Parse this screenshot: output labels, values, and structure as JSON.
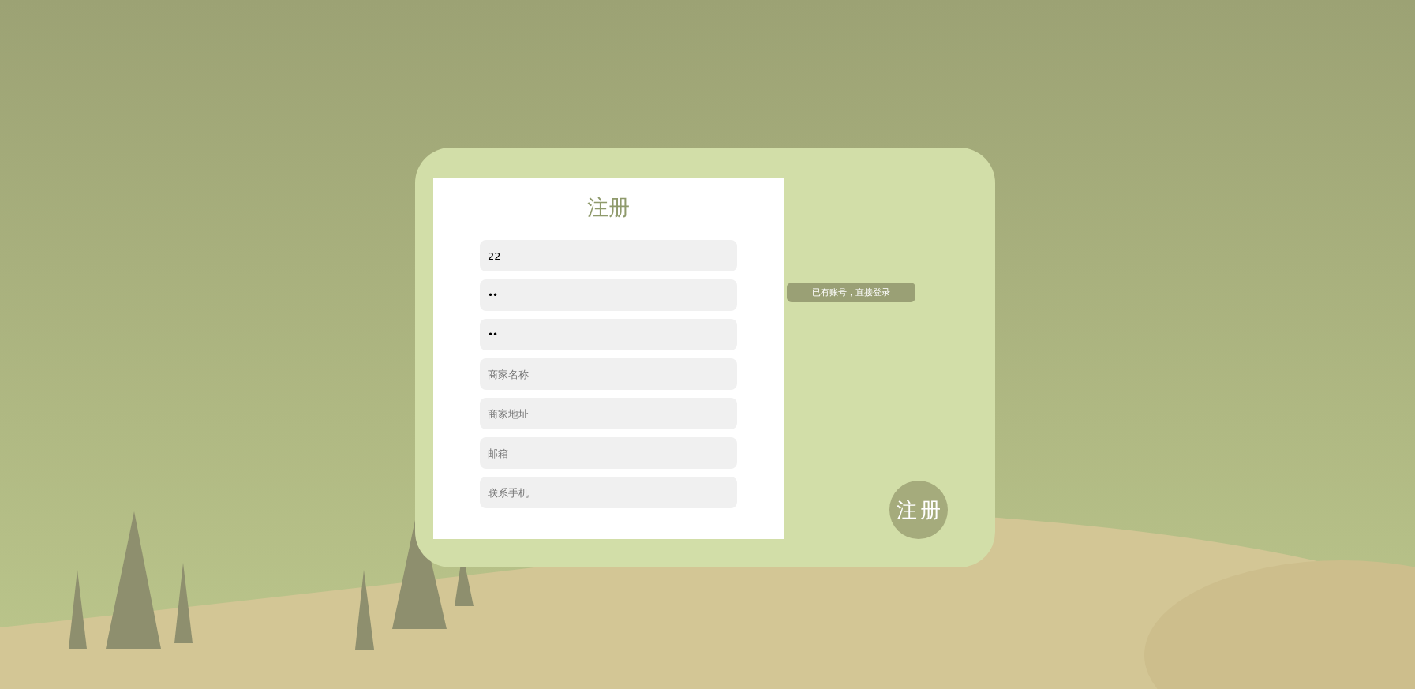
{
  "register_form": {
    "title": "注册",
    "fields": [
      {
        "kind": "text",
        "value": "22"
      },
      {
        "kind": "password",
        "value": "••"
      },
      {
        "kind": "password",
        "value": "••"
      },
      {
        "kind": "text",
        "placeholder": "商家名称"
      },
      {
        "kind": "text",
        "placeholder": "商家地址"
      },
      {
        "kind": "text",
        "placeholder": "邮箱"
      },
      {
        "kind": "text",
        "placeholder": "联系手机"
      }
    ]
  },
  "login_link": "已有账号，直接登录",
  "submit_button": "注册"
}
